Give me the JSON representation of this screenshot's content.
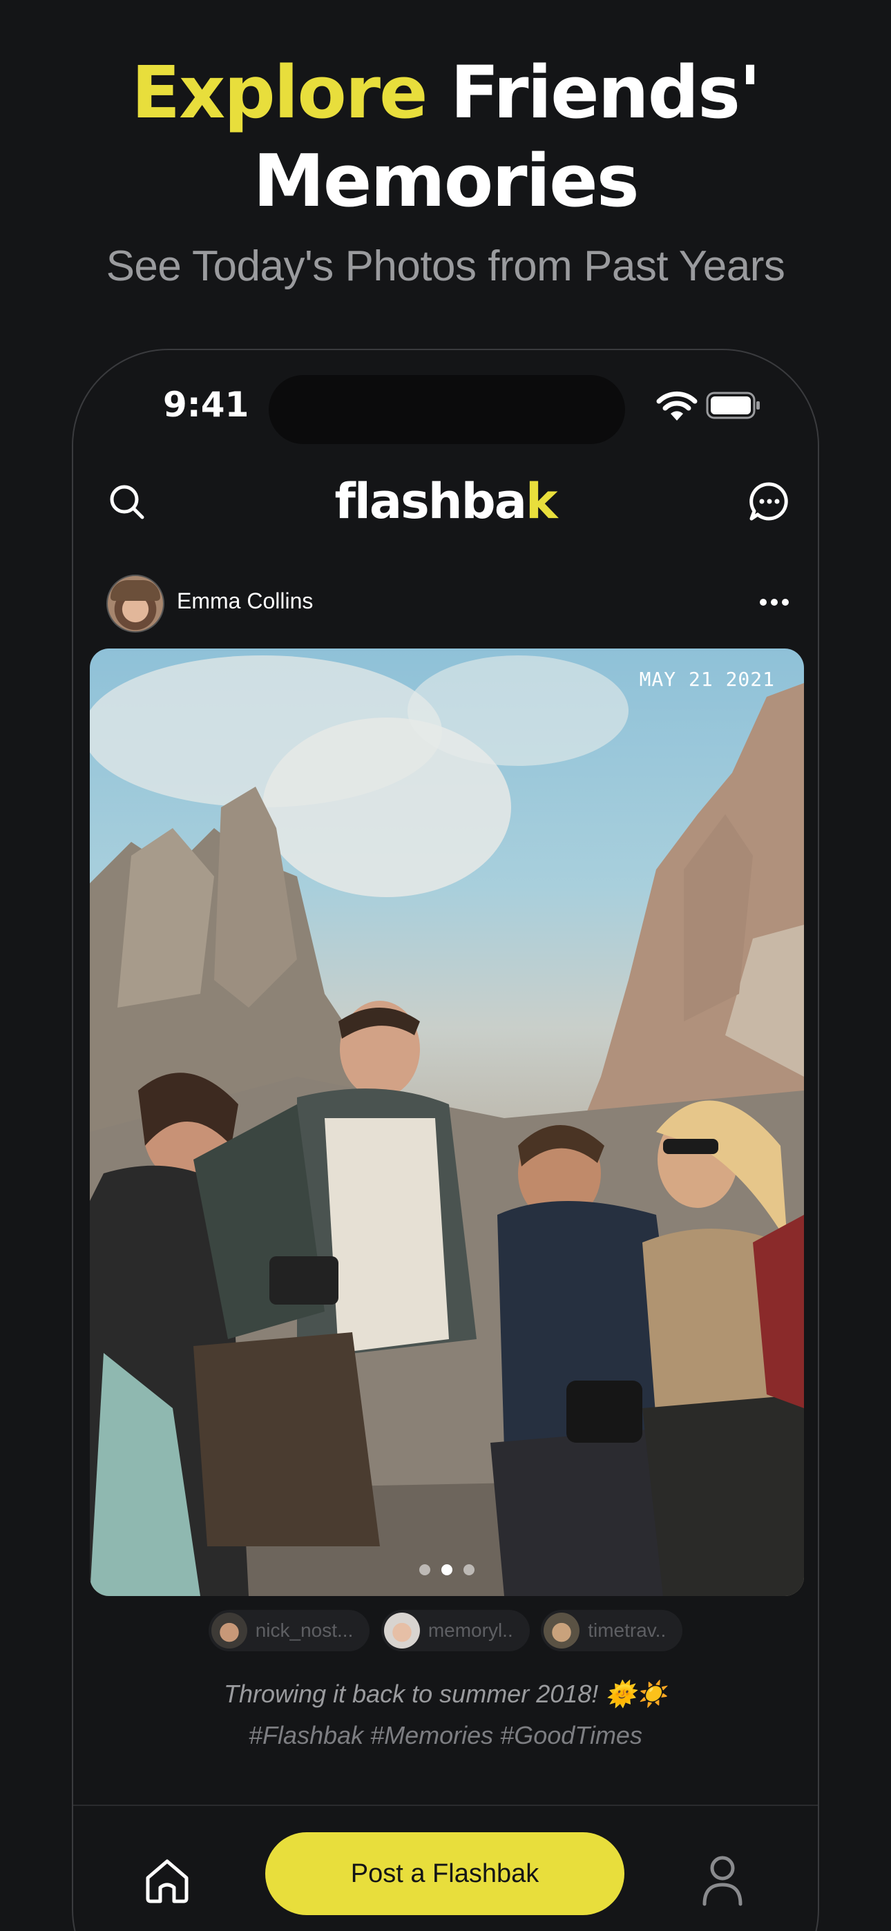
{
  "promo": {
    "headline_accent": "Explore",
    "headline_rest": "Friends'",
    "headline_line2": "Memories",
    "subheadline": "See Today's Photos from Past Years"
  },
  "status_bar": {
    "time": "9:41"
  },
  "app": {
    "logo_main": "flashba",
    "logo_accent": "k"
  },
  "post": {
    "username": "Emma Collins",
    "photo_date": "MAY 21 2021",
    "carousel": {
      "count": 3,
      "active_index": 1
    },
    "tagged": [
      {
        "handle": "nick_nost..."
      },
      {
        "handle": "memoryl.."
      },
      {
        "handle": "timetrav.."
      }
    ],
    "caption": "Throwing it back to summer 2018! 🌞☀️",
    "hashtags": "#Flashbak #Memories #GoodTimes"
  },
  "bottom_nav": {
    "post_button_label": "Post a Flashbak"
  },
  "colors": {
    "background": "#141517",
    "accent": "#e8de3c",
    "muted_text": "#9a9b9e"
  },
  "icons": {
    "search": "search-icon",
    "chat": "chat-bubble-icon",
    "more": "more-horizontal-icon",
    "home": "home-icon",
    "profile": "profile-icon",
    "wifi": "wifi-icon",
    "battery": "battery-icon"
  }
}
